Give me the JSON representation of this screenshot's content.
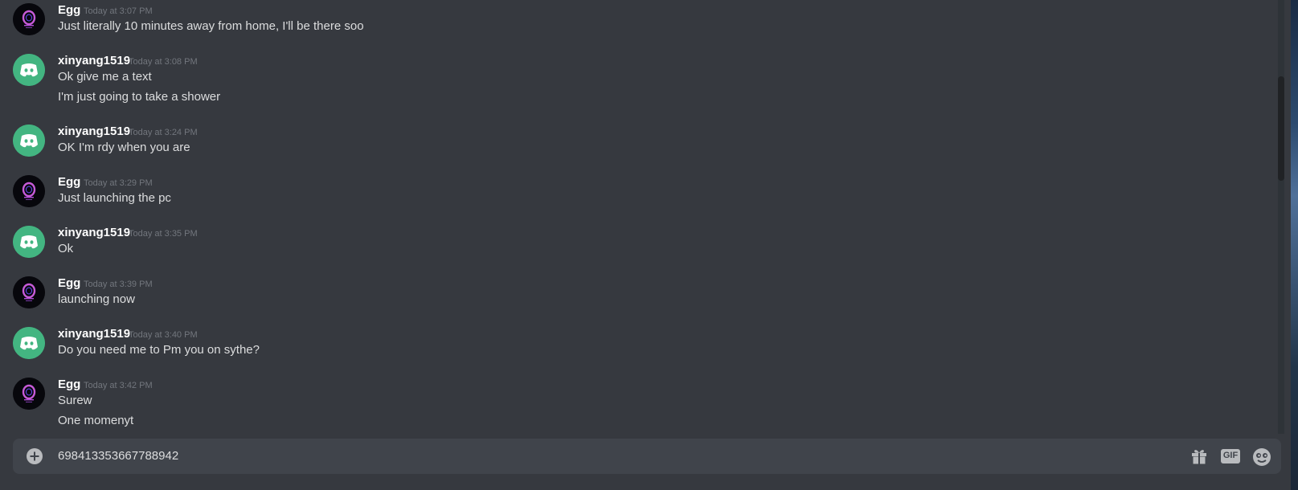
{
  "messages": [
    {
      "author": "Egg",
      "avatar": "egg",
      "timestamp": "Today at 3:07 PM",
      "lines": [
        "Just literally 10 minutes away from home, I'll be there soo"
      ]
    },
    {
      "author": "xinyang1519",
      "avatar": "discord",
      "timestamp": "Today at 3:08 PM",
      "lines": [
        "Ok give me a text",
        "I'm just going to take a shower"
      ]
    },
    {
      "author": "xinyang1519",
      "avatar": "discord",
      "timestamp": "Today at 3:24 PM",
      "lines": [
        "OK I'm rdy when you are"
      ]
    },
    {
      "author": "Egg",
      "avatar": "egg",
      "timestamp": "Today at 3:29 PM",
      "lines": [
        "Just launching the pc"
      ]
    },
    {
      "author": "xinyang1519",
      "avatar": "discord",
      "timestamp": "Today at 3:35 PM",
      "lines": [
        "Ok"
      ]
    },
    {
      "author": "Egg",
      "avatar": "egg",
      "timestamp": "Today at 3:39 PM",
      "lines": [
        "launching now"
      ]
    },
    {
      "author": "xinyang1519",
      "avatar": "discord",
      "timestamp": "Today at 3:40 PM",
      "lines": [
        "Do you need me to Pm you on sythe?"
      ]
    },
    {
      "author": "Egg",
      "avatar": "egg",
      "timestamp": "Today at 3:42 PM",
      "lines": [
        "Surew",
        "One momenyt"
      ]
    }
  ],
  "composer": {
    "value": "698413353667788942",
    "add_icon": "plus-circle-icon",
    "gift_icon": "gift-icon",
    "gif_label": "GIF",
    "emoji_icon": "emoji-icon"
  }
}
